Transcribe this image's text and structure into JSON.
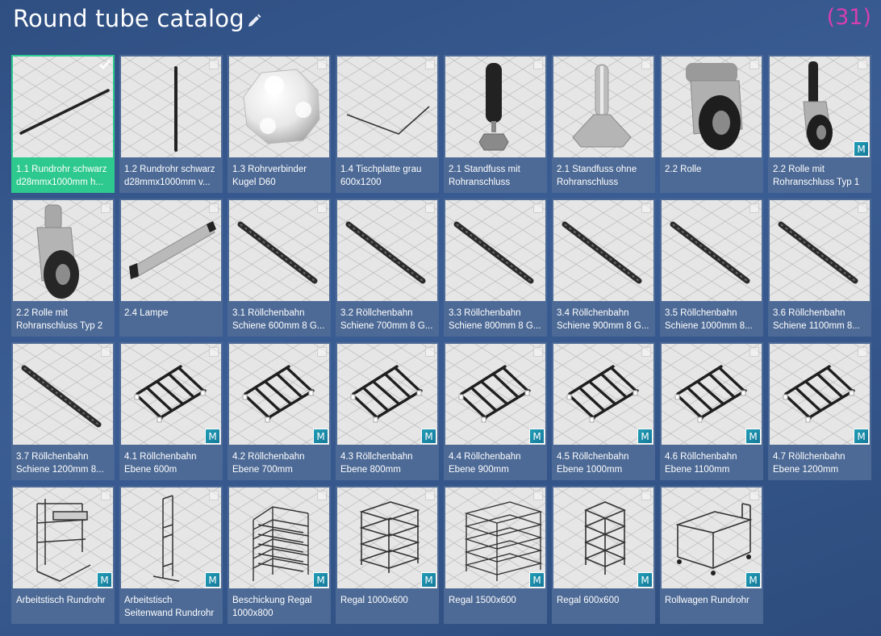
{
  "header": {
    "title": "Round tube catalog",
    "count": "(31)",
    "edit_icon": "pencil-icon"
  },
  "colors": {
    "selected": "#2ec98e",
    "count": "#d63fb0",
    "tile": "#4d6a96",
    "badge": "#1f9db5"
  },
  "items": [
    {
      "label": "1.1 Rundrohr schwarz d28mmx1000mm h...",
      "thumb": "tube-diag",
      "selected": true,
      "badge": ""
    },
    {
      "label": "1.2 Rundrohr schwarz d28mmx1000mm v...",
      "thumb": "tube-vert",
      "selected": false,
      "badge": ""
    },
    {
      "label": "1.3 Rohrverbinder Kugel D60",
      "thumb": "sphere",
      "selected": false,
      "badge": ""
    },
    {
      "label": "1.4 Tischplatte grau 600x1200",
      "thumb": "plate",
      "selected": false,
      "badge": ""
    },
    {
      "label": "2.1 Standfuss mit Rohranschluss",
      "thumb": "foot-tube",
      "selected": false,
      "badge": ""
    },
    {
      "label": "2.1 Standfuss ohne Rohranschluss",
      "thumb": "foot",
      "selected": false,
      "badge": ""
    },
    {
      "label": "2.2 Rolle",
      "thumb": "caster",
      "selected": false,
      "badge": ""
    },
    {
      "label": "2.2 Rolle mit Rohranschluss Typ 1",
      "thumb": "caster-tube",
      "selected": false,
      "badge": "M"
    },
    {
      "label": "2.2 Rolle mit Rohranschluss Typ 2",
      "thumb": "caster-tube2",
      "selected": false,
      "badge": ""
    },
    {
      "label": "2.4 Lampe",
      "thumb": "lamp",
      "selected": false,
      "badge": ""
    },
    {
      "label": "3.1 Röllchenbahn Schiene 600mm 8 G...",
      "thumb": "rail",
      "selected": false,
      "badge": ""
    },
    {
      "label": "3.2 Röllchenbahn Schiene 700mm 8 G...",
      "thumb": "rail",
      "selected": false,
      "badge": ""
    },
    {
      "label": "3.3 Röllchenbahn Schiene 800mm 8 G...",
      "thumb": "rail",
      "selected": false,
      "badge": ""
    },
    {
      "label": "3.4 Röllchenbahn Schiene 900mm 8 G...",
      "thumb": "rail",
      "selected": false,
      "badge": ""
    },
    {
      "label": "3.5 Röllchenbahn Schiene 1000mm 8...",
      "thumb": "rail",
      "selected": false,
      "badge": ""
    },
    {
      "label": "3.6 Röllchenbahn Schiene 1100mm 8...",
      "thumb": "rail",
      "selected": false,
      "badge": ""
    },
    {
      "label": "3.7 Röllchenbahn Schiene 1200mm 8...",
      "thumb": "rail",
      "selected": false,
      "badge": ""
    },
    {
      "label": "4.1 Röllchenbahn Ebene 600m",
      "thumb": "rack",
      "selected": false,
      "badge": "M"
    },
    {
      "label": "4.2 Röllchenbahn Ebene 700mm",
      "thumb": "rack",
      "selected": false,
      "badge": "M"
    },
    {
      "label": "4.3 Röllchenbahn Ebene 800mm",
      "thumb": "rack",
      "selected": false,
      "badge": "M"
    },
    {
      "label": "4.4 Röllchenbahn Ebene 900mm",
      "thumb": "rack",
      "selected": false,
      "badge": "M"
    },
    {
      "label": "4.5 Röllchenbahn Ebene 1000mm",
      "thumb": "rack",
      "selected": false,
      "badge": "M"
    },
    {
      "label": "4.6 Röllchenbahn Ebene 1100mm",
      "thumb": "rack",
      "selected": false,
      "badge": "M"
    },
    {
      "label": "4.7 Röllchenbahn Ebene 1200mm",
      "thumb": "rack",
      "selected": false,
      "badge": "M"
    },
    {
      "label": "Arbeitstisch Rundrohr",
      "thumb": "workbench",
      "selected": false,
      "badge": "M"
    },
    {
      "label": "Arbeitstisch Seitenwand Rundrohr",
      "thumb": "sidewall",
      "selected": false,
      "badge": "M"
    },
    {
      "label": "Beschickung Regal 1000x800",
      "thumb": "flowrack",
      "selected": false,
      "badge": "M"
    },
    {
      "label": "Regal 1000x600",
      "thumb": "shelf",
      "selected": false,
      "badge": "M"
    },
    {
      "label": "Regal 1500x600",
      "thumb": "shelf-wide",
      "selected": false,
      "badge": "M"
    },
    {
      "label": "Regal 600x600",
      "thumb": "shelf-narrow",
      "selected": false,
      "badge": "M"
    },
    {
      "label": "Rollwagen Rundrohr",
      "thumb": "cart",
      "selected": false,
      "badge": "M"
    }
  ]
}
